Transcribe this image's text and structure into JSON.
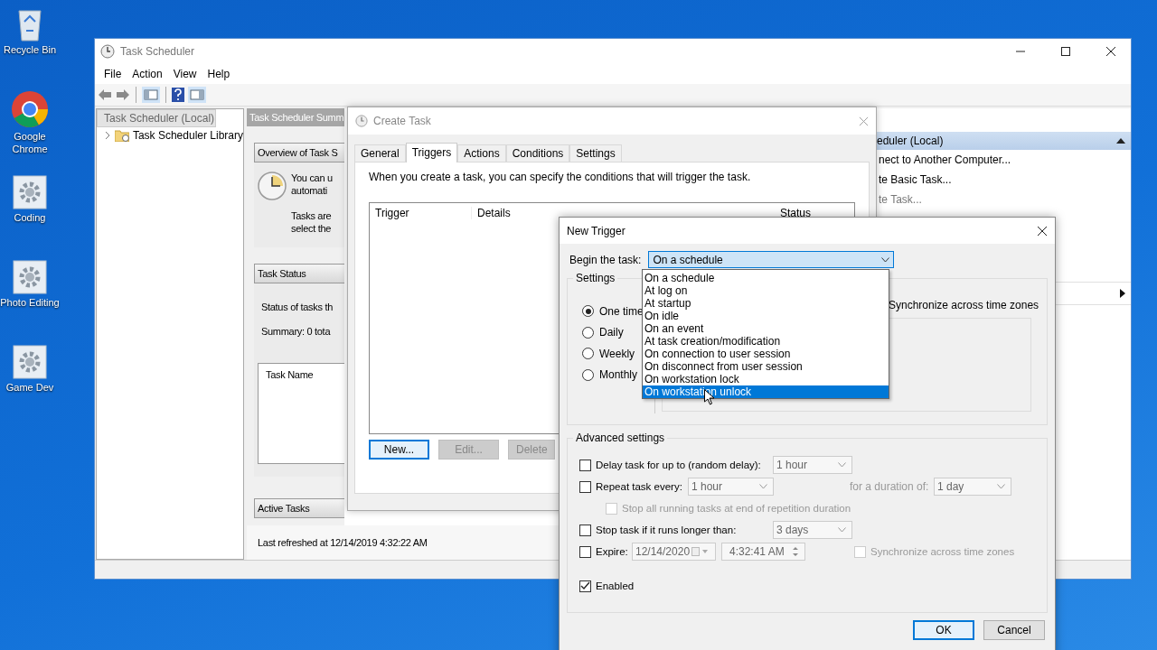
{
  "desktop_icons": [
    {
      "label": "Recycle Bin",
      "kind": "bin"
    },
    {
      "label": "Google Chrome",
      "kind": "browser"
    },
    {
      "label": "Coding",
      "kind": "gear"
    },
    {
      "label": "Photo Editing",
      "kind": "gear"
    },
    {
      "label": "Game Dev",
      "kind": "gear"
    }
  ],
  "main_window": {
    "title": "Task Scheduler",
    "menu": [
      "File",
      "Action",
      "View",
      "Help"
    ],
    "tree": [
      {
        "label": "Task Scheduler (Local)",
        "selected": true,
        "children": [
          {
            "label": "Task Scheduler Library",
            "selected": false,
            "expanded": false
          }
        ]
      }
    ],
    "summary": {
      "title": "Task Scheduler Summ",
      "overview_header": "Overview of Task S",
      "overview_lines": [
        "You can u",
        "automati"
      ],
      "tasks_lines": [
        "Tasks are",
        "select the"
      ],
      "status_header": "Task Status",
      "status_text": "Status of tasks th",
      "summary_text": "Summary: 0 tota",
      "task_name_column": "Task Name",
      "active_header": "Active Tasks",
      "last_refreshed": "Last refreshed at 12/14/2019 4:32:22 AM"
    },
    "actions": {
      "header": "eduler (Local)",
      "items": [
        {
          "label": "nect to Another Computer...",
          "disabled": false
        },
        {
          "label": "te Basic Task...",
          "disabled": false
        },
        {
          "label": "te Task...",
          "disabled": true
        }
      ]
    }
  },
  "create_task": {
    "title": "Create Task",
    "tabs": [
      {
        "label": "General",
        "selected": false
      },
      {
        "label": "Triggers",
        "selected": true
      },
      {
        "label": "Actions",
        "selected": false
      },
      {
        "label": "Conditions",
        "selected": false
      },
      {
        "label": "Settings",
        "selected": false
      }
    ],
    "description": "When you create a task, you can specify the conditions that will trigger the task.",
    "columns": [
      "Trigger",
      "Details",
      "Status"
    ],
    "buttons": [
      {
        "label": "New...",
        "disabled": false
      },
      {
        "label": "Edit...",
        "disabled": true
      },
      {
        "label": "Delete",
        "disabled": true
      }
    ]
  },
  "new_trigger": {
    "title": "New Trigger",
    "begin_label": "Begin the task:",
    "begin_value": "On a schedule",
    "options": [
      {
        "label": "On a schedule",
        "selected": false
      },
      {
        "label": "At log on",
        "selected": false
      },
      {
        "label": "At startup",
        "selected": false
      },
      {
        "label": "On idle",
        "selected": false
      },
      {
        "label": "On an event",
        "selected": false
      },
      {
        "label": "At task creation/modification",
        "selected": false
      },
      {
        "label": "On connection to user session",
        "selected": false
      },
      {
        "label": "On disconnect from user session",
        "selected": false
      },
      {
        "label": "On workstation lock",
        "selected": false
      },
      {
        "label": "On workstation unlock",
        "selected": true
      }
    ],
    "settings_label": "Settings",
    "schedules": [
      {
        "label": "One time",
        "selected": true
      },
      {
        "label": "Daily",
        "selected": false
      },
      {
        "label": "Weekly",
        "selected": false
      },
      {
        "label": "Monthly",
        "selected": false
      }
    ],
    "sync_label": "Synchronize across time zones",
    "advanced_label": "Advanced settings",
    "delay": {
      "label": "Delay task for up to (random delay):",
      "checked": false,
      "value": "1 hour"
    },
    "repeat": {
      "label": "Repeat task every:",
      "checked": false,
      "value": "1 hour",
      "duration_label": "for a duration of:",
      "duration_value": "1 day"
    },
    "stop_all": {
      "label": "Stop all running tasks at end of repetition duration",
      "checked": false,
      "disabled": true
    },
    "stop": {
      "label": "Stop task if it runs longer than:",
      "checked": false,
      "value": "3 days"
    },
    "expire": {
      "label": "Expire:",
      "checked": false,
      "date": "12/14/2020",
      "time": "4:32:41 AM",
      "sync_label": "Synchronize across time zones",
      "sync_checked": false
    },
    "enabled": {
      "label": "Enabled",
      "checked": true
    },
    "buttons": [
      {
        "label": "OK",
        "default": true
      },
      {
        "label": "Cancel",
        "default": false
      }
    ]
  }
}
